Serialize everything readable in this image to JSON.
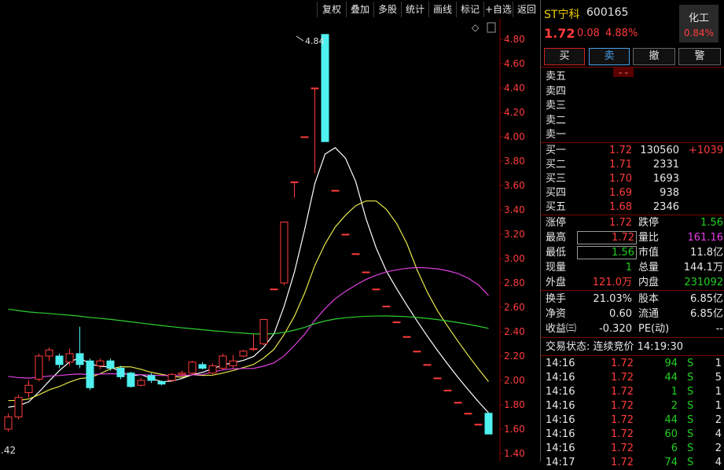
{
  "toolbar": [
    "复权",
    "叠加",
    "多股",
    "统计",
    "画线",
    "标记",
    "+自选",
    "返回"
  ],
  "chart": {
    "price_labels": [
      "4.80",
      "4.60",
      "4.40",
      "4.20",
      "4.00",
      "3.80",
      "3.60",
      "3.40",
      "3.20",
      "3.00",
      "2.80",
      "2.60",
      "2.40",
      "2.20",
      "2.00",
      "1.80",
      "1.60",
      "1.40"
    ],
    "high_label": "4.84",
    "low_label": ".42",
    "diamond": "◇",
    "candles": [
      {
        "o": 1.6,
        "c": 1.7,
        "h": 1.73,
        "l": 1.58
      },
      {
        "o": 1.7,
        "c": 1.86,
        "h": 1.88,
        "l": 1.68
      },
      {
        "o": 1.9,
        "c": 1.96,
        "h": 2.0,
        "l": 1.86
      },
      {
        "o": 2.01,
        "c": 2.2,
        "h": 2.22,
        "l": 1.99
      },
      {
        "o": 2.2,
        "c": 2.25,
        "h": 2.27,
        "l": 2.16
      },
      {
        "o": 2.2,
        "c": 2.13,
        "h": 2.22,
        "l": 2.1
      },
      {
        "o": 2.15,
        "c": 2.22,
        "h": 2.26,
        "l": 2.12
      },
      {
        "o": 2.22,
        "c": 2.13,
        "h": 2.44,
        "l": 2.1
      },
      {
        "o": 2.16,
        "c": 1.94,
        "h": 2.18,
        "l": 1.92
      },
      {
        "o": 2.12,
        "c": 2.16,
        "h": 2.18,
        "l": 2.09
      },
      {
        "o": 2.16,
        "c": 2.1,
        "h": 2.18,
        "l": 2.08
      },
      {
        "o": 2.1,
        "c": 2.03,
        "h": 2.12,
        "l": 2.01
      },
      {
        "o": 2.06,
        "c": 1.95,
        "h": 2.07,
        "l": 1.94
      },
      {
        "o": 1.96,
        "c": 2.0,
        "h": 2.02,
        "l": 1.95
      },
      {
        "o": 2.04,
        "c": 2.0,
        "h": 2.06,
        "l": 1.98
      },
      {
        "o": 1.99,
        "c": 1.97,
        "h": 2.0,
        "l": 1.96
      },
      {
        "o": 2.0,
        "c": 2.05,
        "h": 2.06,
        "l": 1.99
      },
      {
        "o": 2.05,
        "c": 2.06,
        "h": 2.08,
        "l": 2.03
      },
      {
        "o": 2.06,
        "c": 2.15,
        "h": 2.16,
        "l": 2.05
      },
      {
        "o": 2.13,
        "c": 2.1,
        "h": 2.15,
        "l": 2.09
      },
      {
        "o": 2.06,
        "c": 2.12,
        "h": 2.14,
        "l": 2.05
      },
      {
        "o": 2.1,
        "c": 2.2,
        "h": 2.22,
        "l": 2.09
      },
      {
        "o": 2.12,
        "c": 2.16,
        "h": 2.21,
        "l": 2.1
      },
      {
        "o": 2.2,
        "c": 2.24,
        "h": 2.25,
        "l": 2.19
      },
      {
        "o": 2.26,
        "c": 2.26,
        "h": 2.38,
        "l": 2.24
      },
      {
        "o": 2.3,
        "c": 2.5,
        "h": 2.5,
        "l": 2.29
      },
      {
        "o": 2.75,
        "c": 2.75,
        "h": 2.75,
        "l": 2.75
      },
      {
        "o": 2.8,
        "c": 3.3,
        "h": 3.3,
        "l": 2.78
      },
      {
        "o": 3.63,
        "c": 3.63,
        "h": 3.63,
        "l": 3.5
      },
      {
        "o": 4.0,
        "c": 4.0,
        "h": 4.0,
        "l": 4.0
      },
      {
        "o": 4.4,
        "c": 4.4,
        "h": 4.4,
        "l": 3.7
      },
      {
        "o": 4.84,
        "c": 3.96,
        "h": 4.84,
        "l": 3.96
      },
      {
        "o": 3.56,
        "c": 3.56,
        "h": 3.56,
        "l": 3.56
      },
      {
        "o": 3.2,
        "c": 3.2,
        "h": 3.2,
        "l": 3.2
      },
      {
        "o": 3.04,
        "c": 3.04,
        "h": 3.04,
        "l": 3.04
      },
      {
        "o": 2.89,
        "c": 2.89,
        "h": 2.89,
        "l": 2.89
      },
      {
        "o": 2.75,
        "c": 2.75,
        "h": 2.75,
        "l": 2.75
      },
      {
        "o": 2.61,
        "c": 2.61,
        "h": 2.61,
        "l": 2.61
      },
      {
        "o": 2.48,
        "c": 2.48,
        "h": 2.48,
        "l": 2.48
      },
      {
        "o": 2.36,
        "c": 2.36,
        "h": 2.36,
        "l": 2.36
      },
      {
        "o": 2.24,
        "c": 2.24,
        "h": 2.24,
        "l": 2.24
      },
      {
        "o": 2.13,
        "c": 2.13,
        "h": 2.13,
        "l": 2.13
      },
      {
        "o": 2.02,
        "c": 2.02,
        "h": 2.02,
        "l": 2.02
      },
      {
        "o": 1.92,
        "c": 1.92,
        "h": 1.92,
        "l": 1.92
      },
      {
        "o": 1.82,
        "c": 1.82,
        "h": 1.82,
        "l": 1.82
      },
      {
        "o": 1.73,
        "c": 1.73,
        "h": 1.73,
        "l": 1.73
      },
      {
        "o": 1.64,
        "c": 1.64,
        "h": 1.64,
        "l": 1.64
      },
      {
        "o": 1.73,
        "c": 1.56,
        "h": 1.73,
        "l": 1.56
      }
    ],
    "ma_colors": {
      "ma5": "#ffffff",
      "ma10": "#e8e84a",
      "ma20": "#e040e0",
      "ma60": "#2ed12e"
    }
  },
  "quote": {
    "name": "ST宁科",
    "code": "600165",
    "price": "1.72",
    "change": "0.08",
    "change_pct": "4.88%",
    "sector": "化工",
    "sector_pct": "0.84%"
  },
  "actions": [
    "买",
    "卖",
    "撤",
    "警"
  ],
  "asks": [
    "卖五",
    "卖四",
    "卖三",
    "卖二",
    "卖一"
  ],
  "bids": [
    {
      "label": "买一",
      "price": "1.72",
      "vol": "130560",
      "delta": "+1039"
    },
    {
      "label": "买二",
      "price": "1.71",
      "vol": "2331",
      "delta": ""
    },
    {
      "label": "买三",
      "price": "1.70",
      "vol": "1693",
      "delta": ""
    },
    {
      "label": "买四",
      "price": "1.69",
      "vol": "938",
      "delta": ""
    },
    {
      "label": "买五",
      "price": "1.68",
      "vol": "2346",
      "delta": ""
    }
  ],
  "stats": {
    "zhangting_l": "涨停",
    "zhangting_v": "1.72",
    "dieting_l": "跌停",
    "dieting_v": "1.56",
    "high_l": "最高",
    "high_v": "1.72",
    "liangbi_l": "量比",
    "liangbi_v": "161.16",
    "low_l": "最低",
    "low_v": "1.56",
    "shizhi_l": "市值",
    "shizhi_v": "11.8亿",
    "xianliang_l": "现量",
    "xianliang_v": "1",
    "zongliang_l": "总量",
    "zongliang_v": "144.1万",
    "waipan_l": "外盘",
    "waipan_v": "121.0万",
    "neipan_l": "内盘",
    "neipan_v": "231092",
    "huanshou_l": "换手",
    "huanshou_v": "21.03%",
    "guben_l": "股本",
    "guben_v": "6.85亿",
    "jingzi_l": "净资",
    "jingzi_v": "0.60",
    "liutong_l": "流通",
    "liutong_v": "6.85亿",
    "shouyi_l": "收益㈢",
    "shouyi_v": "-0.320",
    "pe_l": "PE(动)",
    "pe_v": "--"
  },
  "trade_status": "交易状态: 连续竞价 14:19:30",
  "ticks": [
    {
      "t": "14:16",
      "p": "1.72",
      "v": "94",
      "s": "S",
      "n": "1"
    },
    {
      "t": "14:16",
      "p": "1.72",
      "v": "44",
      "s": "S",
      "n": "5"
    },
    {
      "t": "14:16",
      "p": "1.72",
      "v": "1",
      "s": "S",
      "n": "1"
    },
    {
      "t": "14:16",
      "p": "1.72",
      "v": "2",
      "s": "S",
      "n": "1"
    },
    {
      "t": "14:16",
      "p": "1.72",
      "v": "44",
      "s": "S",
      "n": "2"
    },
    {
      "t": "14:16",
      "p": "1.72",
      "v": "60",
      "s": "S",
      "n": "4"
    },
    {
      "t": "14:16",
      "p": "1.72",
      "v": "6",
      "s": "S",
      "n": "2"
    },
    {
      "t": "14:17",
      "p": "1.72",
      "v": "74",
      "s": "S",
      "n": "4"
    }
  ]
}
